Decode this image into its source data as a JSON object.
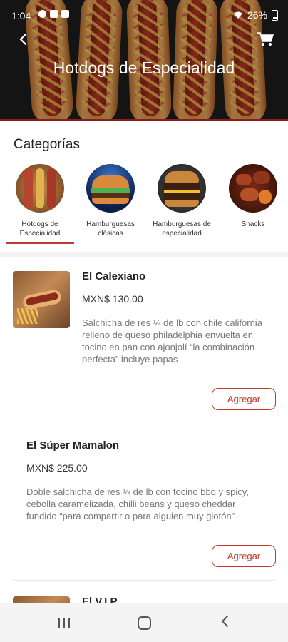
{
  "status_bar": {
    "time": "1:04",
    "battery": "26%"
  },
  "header": {
    "title": "Hotdogs de Especialidad",
    "back_icon": "chevron-left-icon",
    "cart_icon": "cart-icon"
  },
  "categories": {
    "heading": "Categorías",
    "items": [
      {
        "label": "Hotdogs de Especialidad",
        "selected": true
      },
      {
        "label": "Hamburguesas clásicas",
        "selected": false
      },
      {
        "label": "Hamburguesas de especialidad",
        "selected": false
      },
      {
        "label": "Snacks",
        "selected": false
      }
    ]
  },
  "products": [
    {
      "name": "El Calexiano",
      "price": "MXN$ 130.00",
      "description": "Salchicha de res ¼ de lb con chile california relleno de queso philadelphia envuelta en tocino en pan con ajonjolí “la combinación perfecta” incluye papas",
      "button": "Agregar"
    },
    {
      "name": "El Súper Mamalon",
      "price": "MXN$ 225.00",
      "description": "Doble salchicha de res ¼ de lb con tocino bbq y spicy, cebolla caramelizada, chilli beans y queso cheddar fundido “para compartir o para alguien muy glotón”",
      "button": "Agregar"
    },
    {
      "name": "El V.I.P."
    }
  ],
  "colors": {
    "accent": "#c0392b",
    "header_bg": "#1c1c1c"
  }
}
